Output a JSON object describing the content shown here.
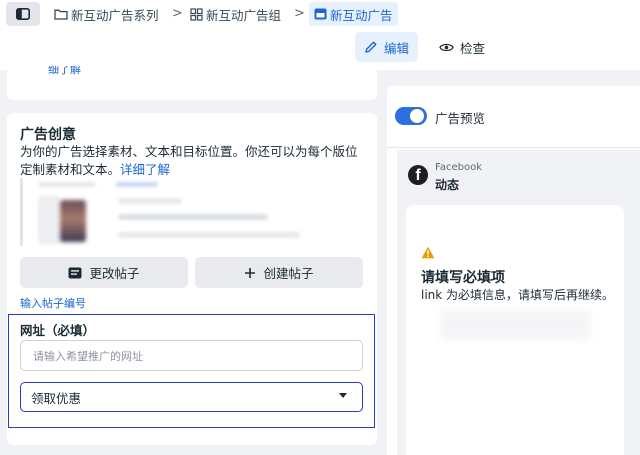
{
  "breadcrumb": {
    "campaign": "新互动广告系列",
    "adset": "新互动广告组",
    "ad": "新互动广告",
    "separator": ">"
  },
  "mode": {
    "edit": "编辑",
    "review": "检查"
  },
  "prev_section": {
    "more_link": "细了解"
  },
  "creative": {
    "title": "广告创意",
    "description": "为你的广告选择素材、文本和目标位置。你还可以为每个版位定制素材和文本。",
    "details_link": "详细了解",
    "change_post_button": "更改帖子",
    "create_post_button": "创建帖子",
    "post_id_link": "输入帖子编号"
  },
  "url": {
    "label": "网址（必填）",
    "placeholder": "请输入希望推广的网址",
    "value": ""
  },
  "cta": {
    "selected": "领取优惠"
  },
  "preview": {
    "toggle_label": "广告预览",
    "platform": "Facebook",
    "placement": "动态",
    "warning_title": "请填写必填项",
    "warning_text": "link 为必填信息，请填写后再继续。"
  },
  "colors": {
    "accent": "#1b66d2",
    "focus": "#2b3bc4",
    "toggle_on": "#2d6ee0",
    "warning": "#e2a100"
  }
}
